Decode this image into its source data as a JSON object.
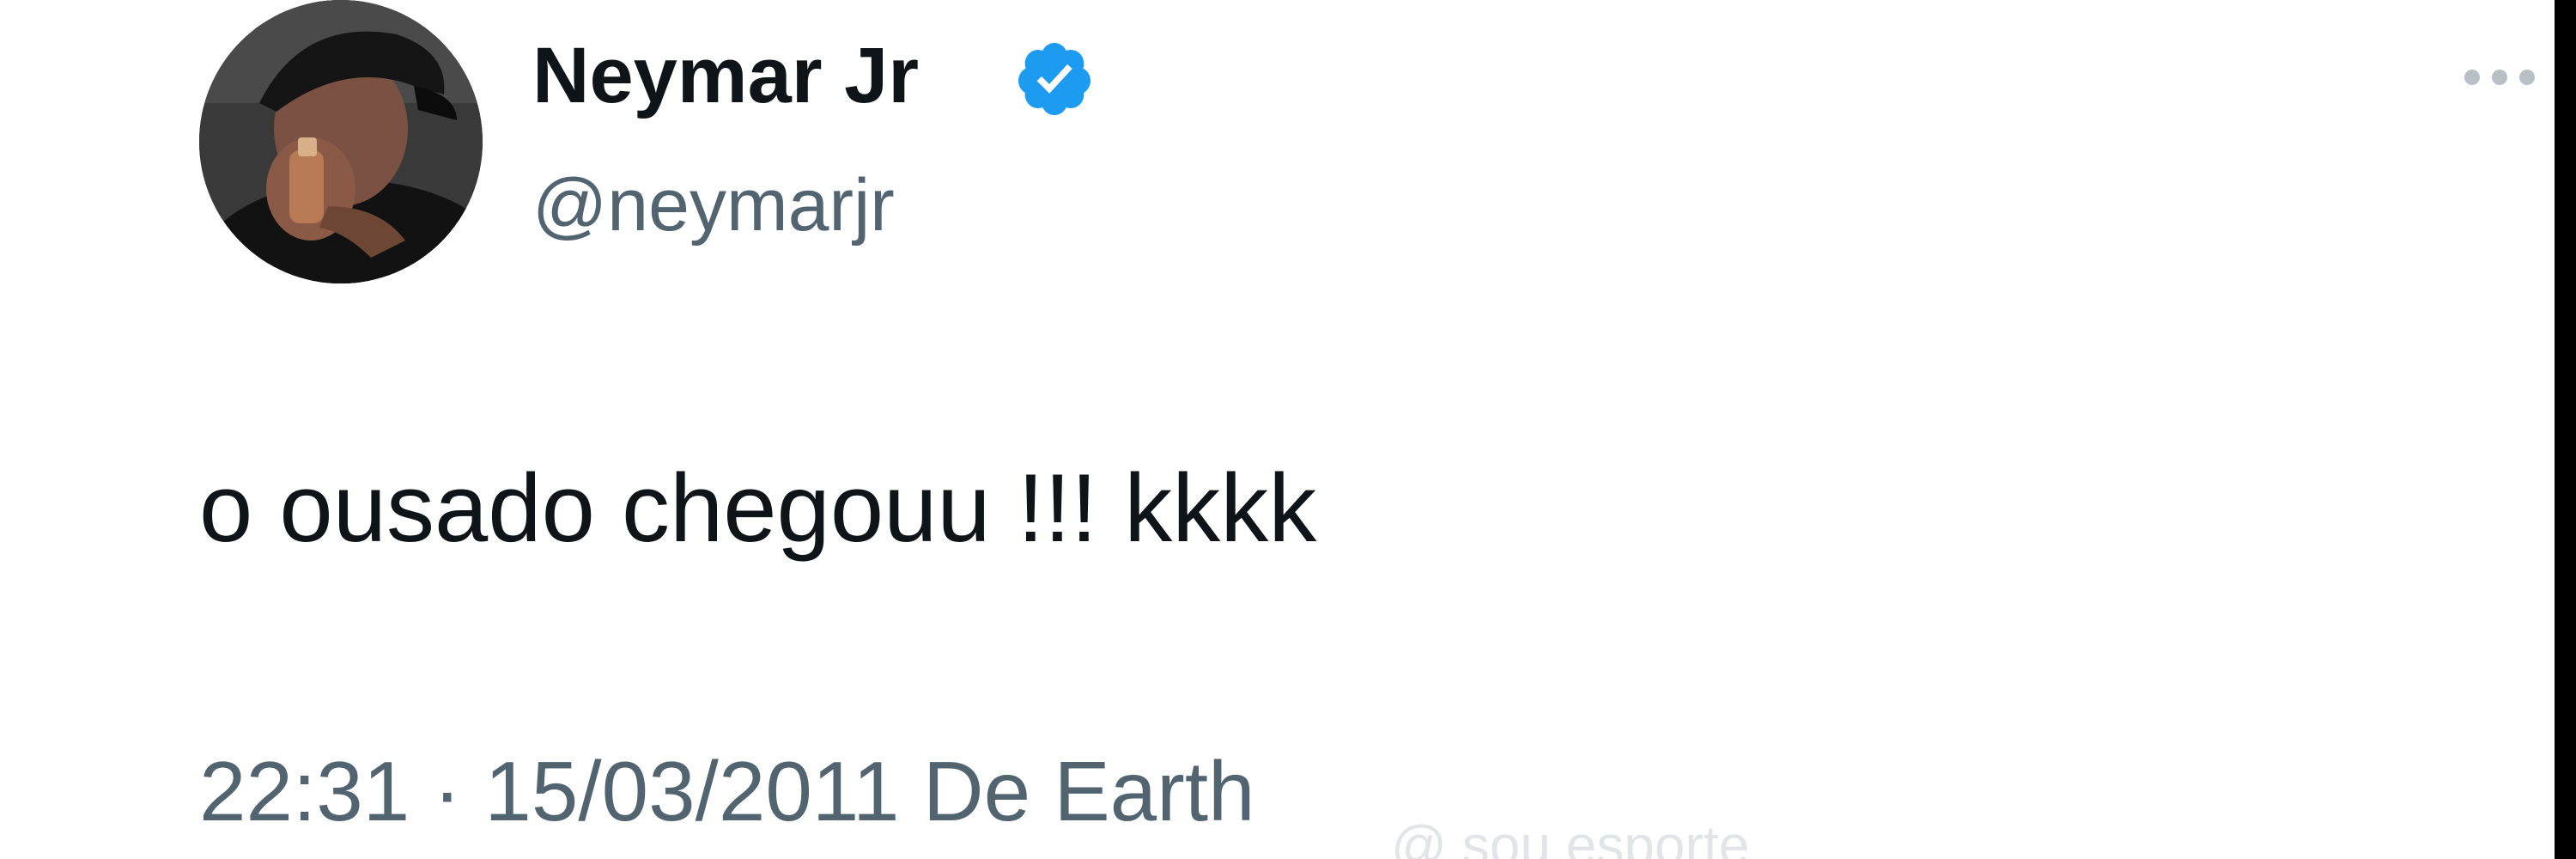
{
  "tweet": {
    "author": {
      "display_name": "Neymar Jr",
      "handle": "@neymarjr",
      "verified": true
    },
    "text": "o ousado chegouu !!! kkkk",
    "meta": {
      "time": "22:31",
      "separator": "·",
      "date": "15/03/2011",
      "source": "De Earth"
    }
  },
  "watermark": "@ sou esporte",
  "icons": {
    "verified": "verified-badge-icon",
    "more": "more-options-icon"
  },
  "colors": {
    "background": "#ffffff",
    "text_primary": "#0f1419",
    "text_secondary": "#536471",
    "verified_blue": "#1d9bf0",
    "frame": "#000000"
  }
}
